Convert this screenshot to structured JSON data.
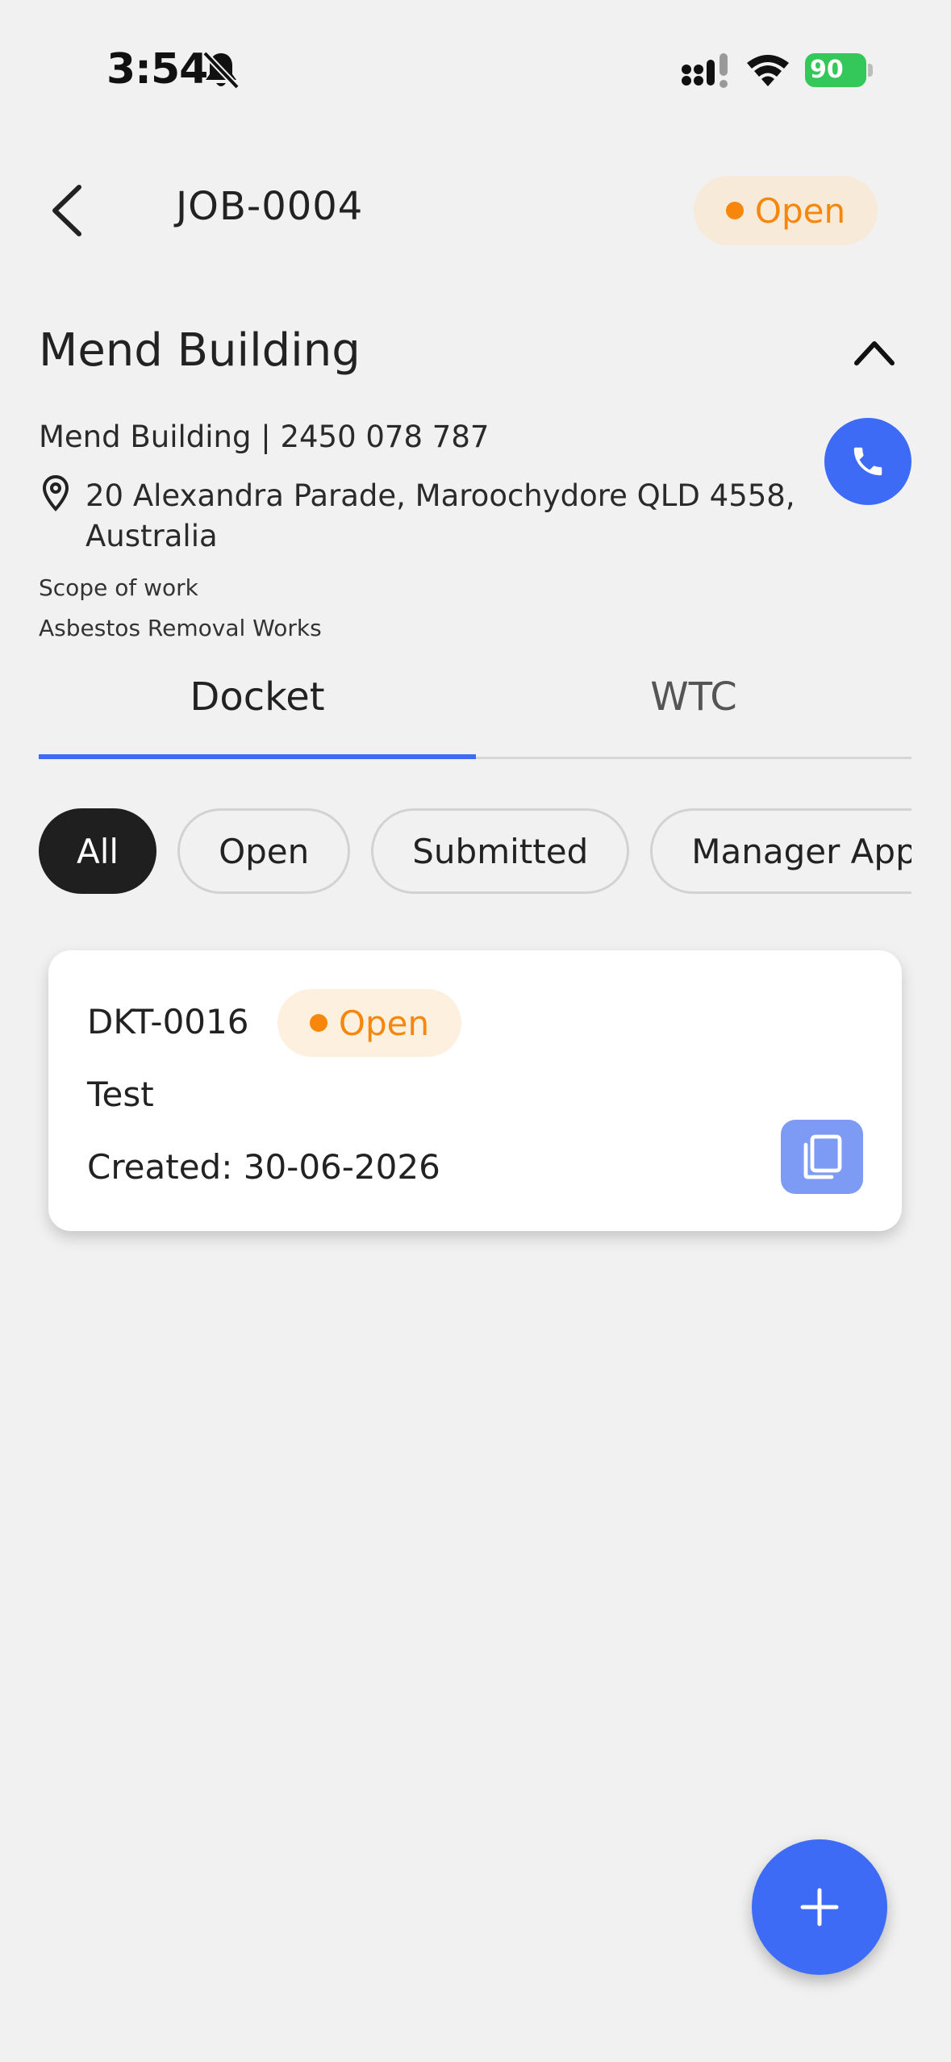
{
  "status_bar": {
    "time": "3:54",
    "battery": "90",
    "icons": [
      "bell-slash-icon",
      "signal-icon",
      "wifi-icon",
      "battery-charging-icon"
    ]
  },
  "header": {
    "title": "JOB-0004",
    "status": "Open",
    "status_color": "#f7870c",
    "back_icon": "chevron-left-icon"
  },
  "building": {
    "name": "Mend Building",
    "contact": "Mend Building | 2450 078 787",
    "address": "20 Alexandra Parade, Maroochydore QLD 4558, Australia",
    "scope_label": "Scope of work",
    "scope_value": "Asbestos Removal Works",
    "collapse_icon": "chevron-up-icon",
    "call_icon": "phone-icon"
  },
  "tabs": [
    {
      "label": "Docket",
      "active": true
    },
    {
      "label": "WTC",
      "active": false
    }
  ],
  "filters": [
    {
      "label": "All",
      "active": true
    },
    {
      "label": "Open",
      "active": false
    },
    {
      "label": "Submitted",
      "active": false
    },
    {
      "label": "Manager Approved",
      "active": false
    }
  ],
  "dockets": [
    {
      "id": "DKT-0016",
      "status": "Open",
      "description": "Test",
      "created": "Created: 30-06-2026",
      "action_icon": "copy-icon"
    }
  ],
  "fab_icon": "plus-icon",
  "colors": {
    "accent": "#3d6bf5",
    "status_open": "#f7870c",
    "background": "#f1f1f1"
  }
}
